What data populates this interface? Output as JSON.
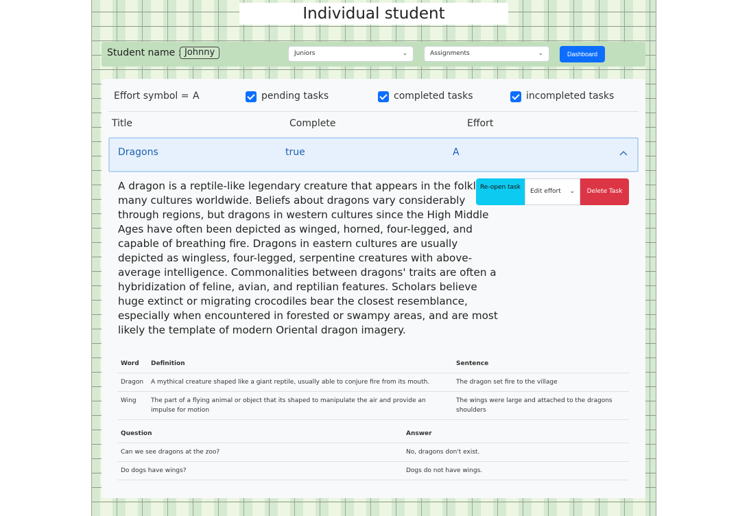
{
  "page": {
    "title": "Individual student"
  },
  "top_bar": {
    "student_label": "Student name :",
    "student_name": "Johnny",
    "group_select": "Juniors",
    "assignment_select": "Assignments",
    "dashboard_label": "Dashboard",
    "chevron": "⌄"
  },
  "filters": {
    "effort_label": "Effort symbol =",
    "effort_value": "A",
    "pending": "pending tasks",
    "completed": "completed tasks",
    "incompleted": "incompleted tasks"
  },
  "columns": {
    "title": "Title",
    "complete": "Complete",
    "effort": "Effort"
  },
  "task": {
    "title": "Dragons",
    "complete": "true",
    "effort": "A",
    "description": "A dragon is a reptile-like legendary creature that appears in the folklore of many cultures worldwide. Beliefs about dragons vary considerably through regions, but dragons in western cultures since the High Middle Ages have often been depicted as winged, horned, four-legged, and capable of breathing fire. Dragons in eastern cultures are usually depicted as wingless, four-legged, serpentine creatures with above-average intelligence. Commonalities between dragons' traits are often a hybridization of feline, avian, and reptilian features. Scholars believe huge extinct or migrating crocodiles bear the closest resemblance, especially when encountered in forested or swampy areas, and are most likely the template of modern Oriental dragon imagery.",
    "actions": {
      "reopen": "Re-open task",
      "edit_effort": "Edit effort",
      "delete": "Delete Task"
    }
  },
  "vocab": {
    "headers": {
      "word": "Word",
      "definition": "Definition",
      "sentence": "Sentence"
    },
    "rows": [
      {
        "word": "Dragon",
        "definition": "A mythical creature shaped like a giant reptile, usually able to conjure fire from its mouth.",
        "sentence": "The dragon set fire to the village"
      },
      {
        "word": "Wing",
        "definition": "The part of a flying animal or object that its shaped to manipulate the air and provide an impulse for motion",
        "sentence": "The wings were large and attached to the dragons shoulders"
      }
    ]
  },
  "qa": {
    "headers": {
      "question": "Question",
      "answer": "Answer"
    },
    "rows": [
      {
        "question": "Can we see dragons at the zoo?",
        "answer": "No, dragons don't exist."
      },
      {
        "question": "Do dogs have wings?",
        "answer": "Dogs do not have wings."
      }
    ]
  },
  "colors": {
    "primary": "#0d6efd",
    "info": "#0dcaf0",
    "danger": "#dc3545",
    "accent_bar": "#c2dfbd"
  }
}
